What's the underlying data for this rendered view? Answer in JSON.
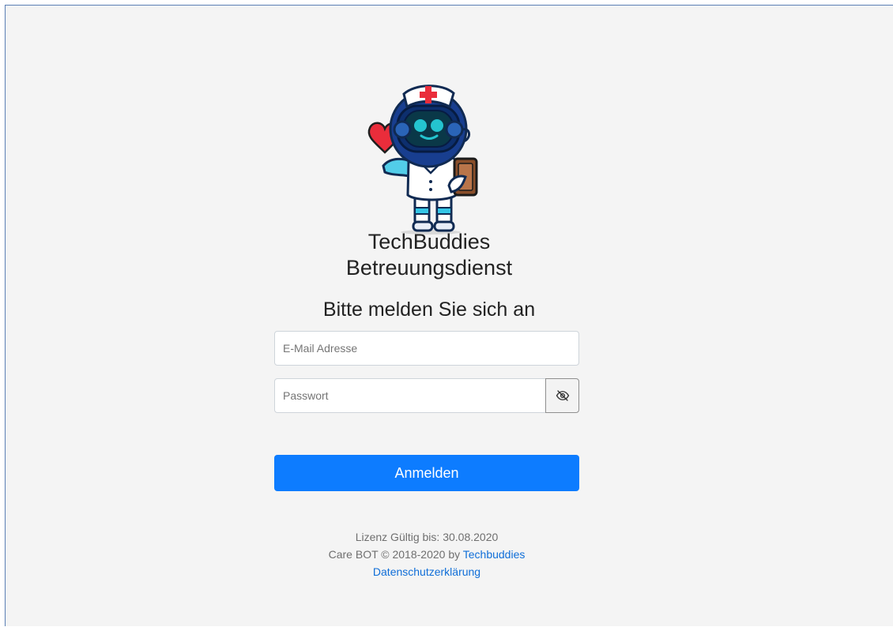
{
  "brand": {
    "line1": "TechBuddies",
    "line2": "Betreuungsdienst"
  },
  "login": {
    "heading": "Bitte melden Sie sich an",
    "email_placeholder": "E-Mail Adresse",
    "password_placeholder": "Passwort",
    "submit_label": "Anmelden"
  },
  "footer": {
    "license": "Lizenz Gültig bis: 30.08.2020",
    "copyright_prefix": "Care BOT © 2018-2020 by",
    "company_link": "Techbuddies",
    "privacy_link": "Datenschutzerklärung"
  },
  "icons": {
    "password_toggle": "eye-slash-icon",
    "logo": "nurse-robot-mascot"
  },
  "colors": {
    "primary": "#0d7cff",
    "link": "#0f6ed8",
    "background": "#f4f4f4",
    "text": "#222222",
    "muted": "#6f6f6f",
    "border": "#ced4da"
  }
}
